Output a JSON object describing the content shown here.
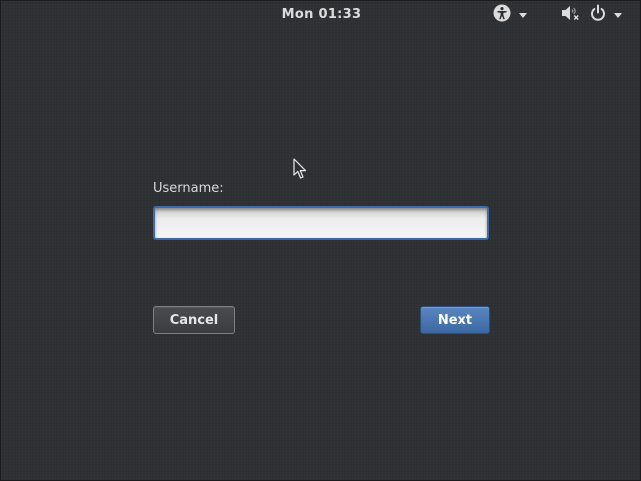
{
  "topbar": {
    "clock": "Mon 01:33",
    "icons": {
      "accessibility": "accessibility-icon",
      "volume": "volume-muted-icon",
      "power": "power-icon",
      "chevron": "chevron-down-icon"
    }
  },
  "login": {
    "username_label": "Username:",
    "username_value": "",
    "username_placeholder": ""
  },
  "buttons": {
    "cancel": "Cancel",
    "next": "Next"
  },
  "colors": {
    "background": "#2d3032",
    "accent": "#3b68a2",
    "focus_border": "#3d6aa8"
  }
}
